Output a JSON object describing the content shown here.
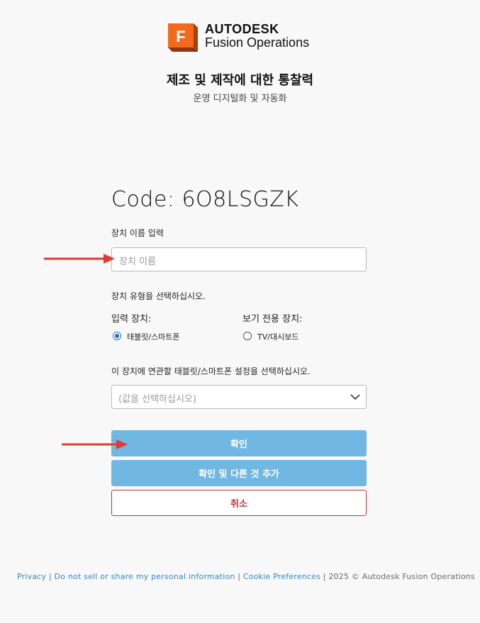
{
  "header": {
    "brand_line1": "AUTODESK",
    "brand_line2": "Fusion Operations",
    "logo_letter": "F",
    "headline": "제조 및 제작에 대한 통찰력",
    "subline": "운영 디지털화 및 자동화"
  },
  "form": {
    "code_text": "Code: 6O8LSGZK",
    "device_name_label": "장치 이름 입력",
    "device_name_placeholder": "장치 이름",
    "device_name_value": "",
    "device_type_question": "장치 유형을 선택하십시오.",
    "input_device_heading": "입력 장치:",
    "view_only_heading": "보기 전용 장치:",
    "options": [
      {
        "label": "태블릿/스마트폰",
        "checked": true
      },
      {
        "label": "TV/대시보드",
        "checked": false
      }
    ],
    "assoc_question": "이 장치에 연관할 태블릿/스마트폰 설정을 선택하십시오.",
    "select_placeholder": "(값을 선택하십시오)"
  },
  "buttons": {
    "confirm": "확인",
    "confirm_add": "확인 및 다른 것 추가",
    "cancel": "취소"
  },
  "footer": {
    "privacy": "Privacy",
    "sep1": " | ",
    "do_not_sell": "Do not sell or share my personal information",
    "sep2": " | ",
    "cookie": "Cookie Preferences",
    "copyright": " | 2025 © Autodesk Fusion Operations"
  },
  "colors": {
    "primary_button": "#70b7e1",
    "cancel_red": "#c8303a",
    "arrow_red": "#e03a3a",
    "link_blue": "#3b87b5",
    "logo_orange": "#f26b1d"
  },
  "icons": {
    "logo": "autodesk-fusion-logo",
    "chevron": "chevron-down-icon",
    "annotation_arrows": "red-arrow-icon"
  }
}
